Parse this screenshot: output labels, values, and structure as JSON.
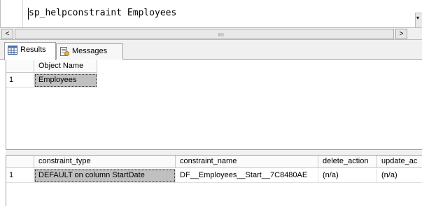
{
  "editor": {
    "query": "sp_helpconstraint Employees"
  },
  "scrollbar": {
    "left_arrow": "<",
    "right_arrow": ">",
    "grip": "III"
  },
  "tabs": [
    {
      "label": "Results",
      "active": true
    },
    {
      "label": "Messages",
      "active": false
    }
  ],
  "grid1": {
    "columns": [
      "Object Name"
    ],
    "rows": [
      {
        "num": "1",
        "cells": [
          "Employees"
        ]
      }
    ]
  },
  "grid2": {
    "columns": [
      "constraint_type",
      "constraint_name",
      "delete_action",
      "update_ac"
    ],
    "rows": [
      {
        "num": "1",
        "cells": [
          "DEFAULT on column StartDate",
          "DF__Employees__Start__7C8480AE",
          "(n/a)",
          "(n/a)"
        ]
      }
    ]
  },
  "colors": {
    "selected_cell": "#c0c0c0",
    "chrome": "#f0f0f0",
    "border": "#a0a0a0"
  }
}
